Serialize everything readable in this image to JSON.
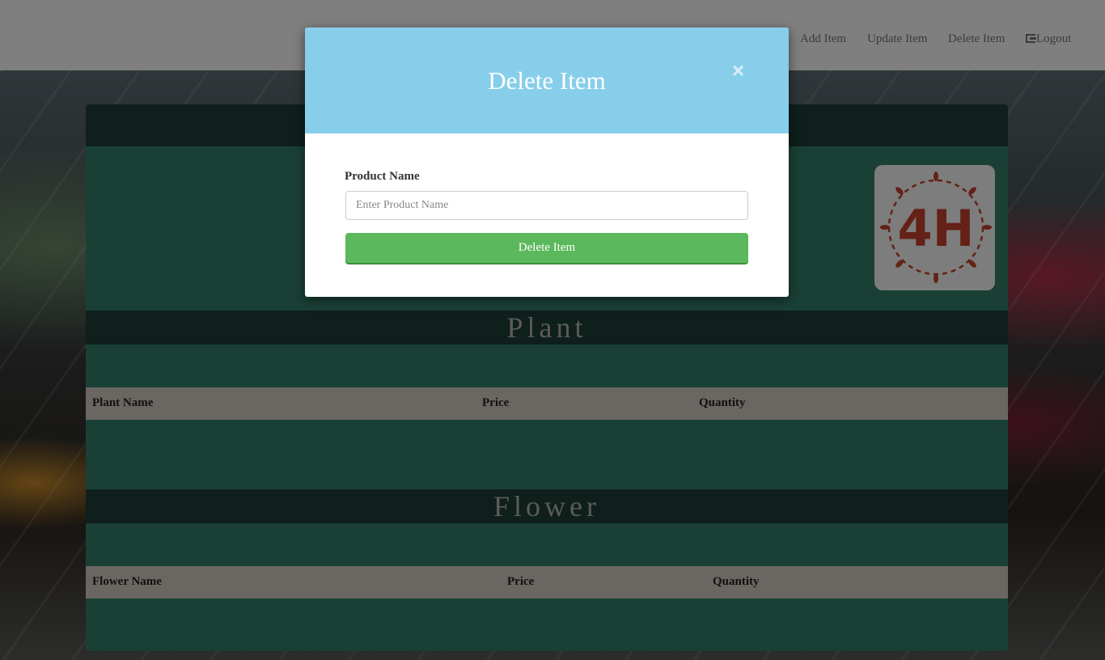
{
  "nav": {
    "add_item": "Add Item",
    "update_item": "Update Item",
    "delete_item": "Delete Item",
    "logout": "Logout"
  },
  "logo": {
    "text": "4H"
  },
  "sections": {
    "plant": {
      "title": "Plant",
      "columns": [
        "Plant Name",
        "Price",
        "Quantity"
      ]
    },
    "flower": {
      "title": "Flower",
      "columns": [
        "Flower Name",
        "Price",
        "Quantity"
      ]
    }
  },
  "modal": {
    "title": "Delete Item",
    "close": "×",
    "field_label": "Product Name",
    "field_placeholder": "Enter Product Name",
    "field_value": "",
    "submit_label": "Delete Item"
  },
  "colors": {
    "modal_header": "#87ceeb",
    "submit": "#5cb85c",
    "panel": "#35806d",
    "bar": "#1d3f38",
    "logo_accent": "#c8432f"
  }
}
